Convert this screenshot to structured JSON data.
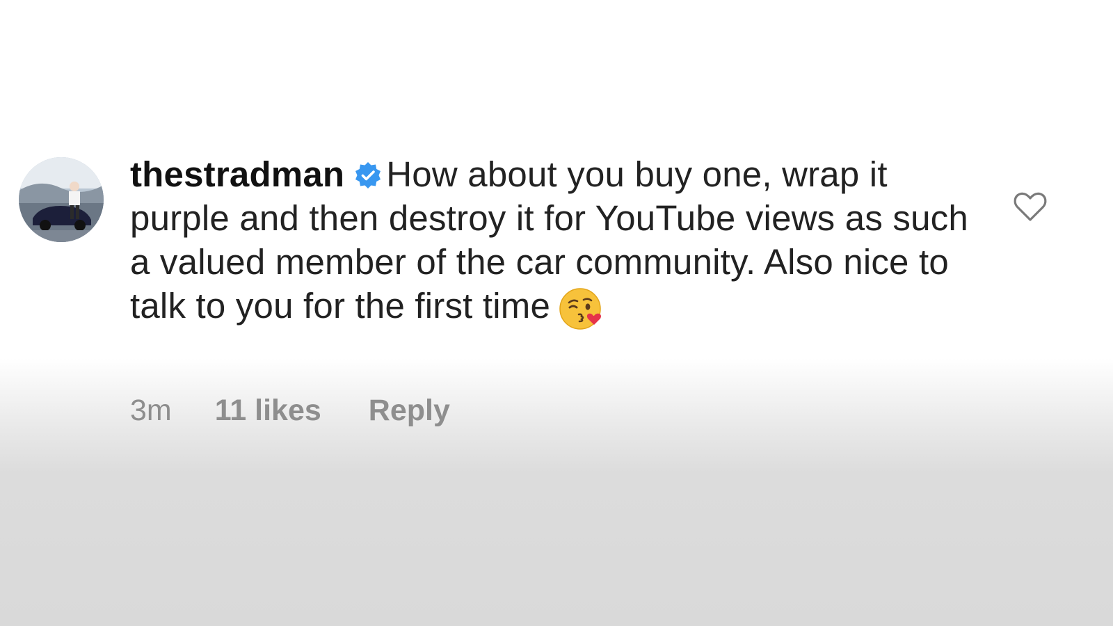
{
  "comment": {
    "username": "thestradman",
    "verified_icon": "verified-badge-icon",
    "text": "How about you buy one, wrap it purple and then destroy it for YouTube views as such a valued member of the car community.  Also nice to talk to you for the first time",
    "emoji": "kissing-face-with-heart-icon",
    "time": "3m",
    "likes": "11 likes",
    "reply_label": "Reply",
    "like_icon": "heart-outline-icon"
  },
  "colors": {
    "text": "#222222",
    "meta": "#8e8e8e",
    "verified": "#3897f0"
  }
}
